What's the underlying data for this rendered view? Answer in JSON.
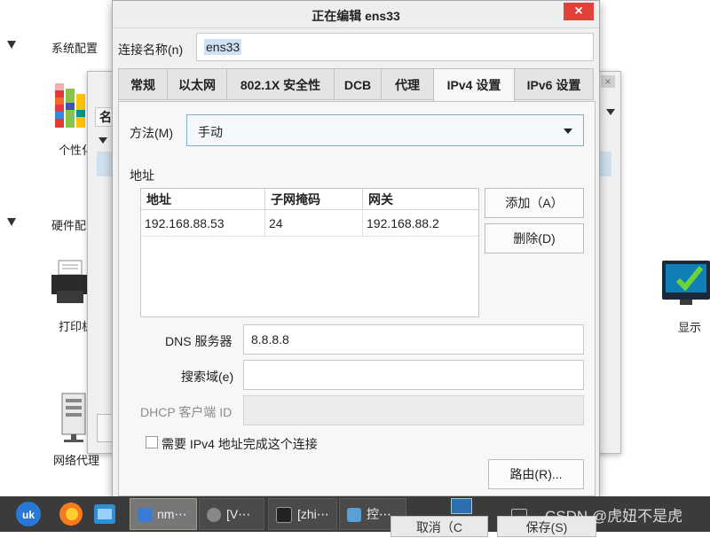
{
  "background": {
    "sections": [
      {
        "label": "系统配置"
      },
      {
        "label": "硬件配"
      }
    ],
    "items": {
      "personal": "个性化",
      "printer": "打印机",
      "proxy": "网络代理",
      "display": "显示"
    }
  },
  "middle_dialog": {
    "list_header": "名"
  },
  "edit_dialog": {
    "title": "正在编辑 ens33",
    "close_glyph": "×",
    "connection_name_label": "连接名称(n)",
    "connection_name_value": "ens33",
    "tabs": [
      {
        "label": "常规"
      },
      {
        "label": "以太网"
      },
      {
        "label": "802.1X 安全性"
      },
      {
        "label": "DCB"
      },
      {
        "label": "代理"
      },
      {
        "label": "IPv4 设置",
        "active": true
      },
      {
        "label": "IPv6 设置"
      }
    ],
    "method_label": "方法(M)",
    "method_value": "手动",
    "address_section": "地址",
    "address_table": {
      "headers": [
        "地址",
        "子网掩码",
        "网关"
      ],
      "rows": [
        [
          "192.168.88.53",
          "24",
          "192.168.88.2"
        ]
      ]
    },
    "add_button": "添加（A）",
    "delete_button": "删除(D)",
    "dns_label": "DNS 服务器",
    "dns_value": "8.8.8.8",
    "search_domain_label": "搜索域(e)",
    "search_domain_value": "",
    "dhcp_client_id_label": "DHCP 客户端 ID",
    "dhcp_client_id_value": "",
    "require_ipv4_label": "需要 IPv4 地址完成这个连接",
    "require_ipv4_checked": false,
    "routes_button": "路由(R)...",
    "cancel_button": "取消（C",
    "save_button": "保存(S)"
  },
  "taskbar": {
    "items": [
      {
        "label": "nm⋯",
        "active": true
      },
      {
        "label": "[V⋯"
      },
      {
        "label": "[zhi⋯"
      },
      {
        "label": "控⋯"
      }
    ],
    "watermark": "CSDN @虎妞不是虎"
  },
  "colors": {
    "close_red": "#e0423a",
    "selection_blue": "#cfe2f3",
    "taskbar_bg": "#3b3b3b"
  }
}
